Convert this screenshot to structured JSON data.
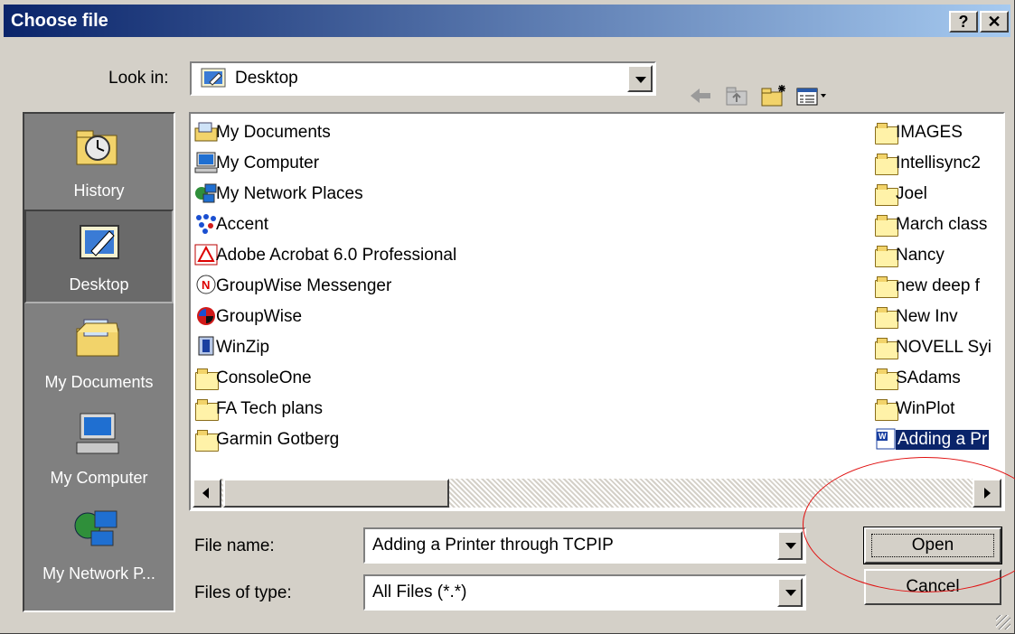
{
  "window": {
    "title": "Choose file",
    "help_label": "?",
    "close_label": "✕"
  },
  "look_in": {
    "label": "Look in:",
    "value": "Desktop",
    "icon": "desktop-icon"
  },
  "toolbar": {
    "back_icon": "back-arrow-icon",
    "up_icon": "up-folder-icon",
    "new_folder_icon": "new-folder-icon",
    "views_icon": "views-menu-icon"
  },
  "places": [
    {
      "label": "History",
      "icon": "history-icon"
    },
    {
      "label": "Desktop",
      "icon": "desktop-icon"
    },
    {
      "label": "My Documents",
      "icon": "my-documents-icon"
    },
    {
      "label": "My Computer",
      "icon": "my-computer-icon"
    },
    {
      "label": "My Network P...",
      "icon": "network-places-icon"
    }
  ],
  "files_col1": [
    {
      "name": "My Documents",
      "icon": "my-documents-icon"
    },
    {
      "name": "My Computer",
      "icon": "my-computer-icon"
    },
    {
      "name": "My Network Places",
      "icon": "network-places-icon"
    },
    {
      "name": "Accent",
      "icon": "accent-shortcut-icon"
    },
    {
      "name": "Adobe Acrobat 6.0 Professional",
      "icon": "acrobat-shortcut-icon"
    },
    {
      "name": "GroupWise Messenger",
      "icon": "groupwise-messenger-shortcut-icon"
    },
    {
      "name": "GroupWise",
      "icon": "groupwise-shortcut-icon"
    },
    {
      "name": "WinZip",
      "icon": "winzip-shortcut-icon"
    },
    {
      "name": "ConsoleOne",
      "icon": "folder-icon"
    },
    {
      "name": "FA Tech plans",
      "icon": "folder-icon"
    },
    {
      "name": "Garmin Gotberg",
      "icon": "folder-icon"
    }
  ],
  "files_col2": [
    {
      "name": "IMAGES",
      "icon": "folder-icon"
    },
    {
      "name": "Intellisync2",
      "icon": "folder-icon"
    },
    {
      "name": "Joel",
      "icon": "folder-icon"
    },
    {
      "name": "March class",
      "icon": "folder-icon"
    },
    {
      "name": "Nancy",
      "icon": "folder-icon"
    },
    {
      "name": "new deep f",
      "icon": "folder-icon"
    },
    {
      "name": "New Inv",
      "icon": "folder-icon"
    },
    {
      "name": "NOVELL Syi",
      "icon": "folder-icon"
    },
    {
      "name": "SAdams",
      "icon": "folder-icon"
    },
    {
      "name": "WinPlot",
      "icon": "folder-icon"
    },
    {
      "name": "Adding a Pr",
      "icon": "word-document-icon",
      "selected": true
    }
  ],
  "file_name": {
    "label": "File name:",
    "value": "Adding a Printer through TCPIP"
  },
  "file_type": {
    "label": "Files of type:",
    "value": "All Files (*.*)"
  },
  "buttons": {
    "open": "Open",
    "cancel": "Cancel"
  },
  "colors": {
    "titlebar_start": "#0a246a",
    "titlebar_end": "#a6caf0",
    "selection": "#0a246a",
    "annotation_circle": "#e01010"
  }
}
